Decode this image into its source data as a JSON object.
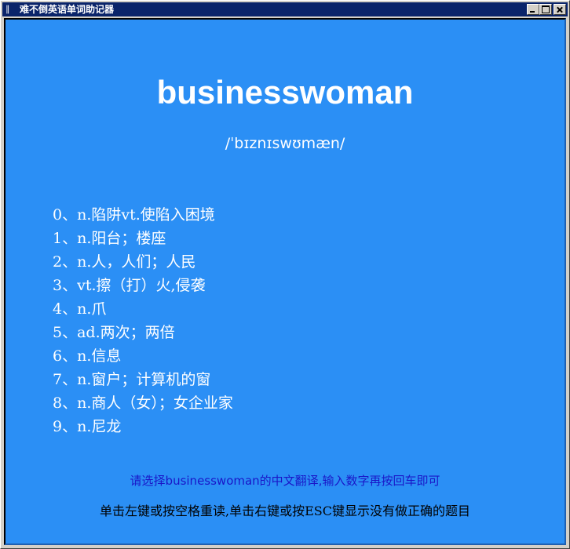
{
  "window": {
    "title": "难不倒英语单词助记器",
    "icon": "app-icon",
    "controls": [
      "minimize",
      "maximize",
      "close"
    ]
  },
  "word": {
    "text": "businesswoman",
    "phonetic": "/ˈbɪznɪswʊmæn/"
  },
  "meanings": [
    "0、n.陷阱vt.使陷入困境",
    "1、n.阳台；楼座",
    "2、n.人，人们；人民",
    "3、vt.擦（打）火,侵袭",
    "4、n.爪",
    "5、ad.两次；两倍",
    "6、n.信息",
    "7、n.窗户；计算机的窗",
    "8、n.商人（女）；女企业家",
    "9、n.尼龙"
  ],
  "prompt": "请选择businesswoman的中文翻译,输入数字再按回车即可",
  "hint": "单击左键或按空格重读,单击右键或按ESC键显示没有做正确的题目",
  "colors": {
    "background": "#2b8ff5",
    "titlebar": "#0a246a",
    "prompt": "#1a16c8"
  }
}
